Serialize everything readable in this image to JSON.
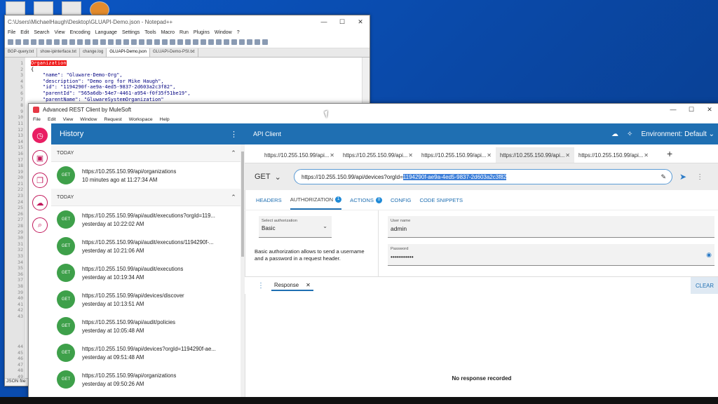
{
  "notepad": {
    "title": "C:\\Users\\MichaelHaugh\\Desktop\\GLUAPI-Demo.json - Notepad++",
    "menu": [
      "File",
      "Edit",
      "Search",
      "View",
      "Encoding",
      "Language",
      "Settings",
      "Tools",
      "Macro",
      "Run",
      "Plugins",
      "Window",
      "?"
    ],
    "tabs": [
      "BGP-query.txt",
      "show-ipinterface.txt",
      "change.log",
      "GLUAPI-Demo.json",
      "GLUAPI-Demo-PSI.txt"
    ],
    "active_tab_index": 3,
    "line_numbers": [
      "1",
      "2",
      "3",
      "4",
      "5",
      "6",
      "7",
      "8",
      "9",
      "10",
      "11",
      "12",
      "13",
      "14",
      "15",
      "16",
      "17",
      "18",
      "19",
      "20",
      "21",
      "22",
      "23",
      "24",
      "25",
      "26",
      "27",
      "28",
      "29",
      "30",
      "31",
      "32",
      "33",
      "34",
      "35",
      "36",
      "37",
      "38",
      "39",
      "40",
      "41",
      "42",
      "43",
      "",
      "",
      "",
      "",
      "44",
      "45",
      "46",
      "47",
      "48",
      "49"
    ],
    "code_lines": [
      {
        "text": "",
        "type": "plain"
      },
      {
        "text": "Organization",
        "type": "hl"
      },
      {
        "text": "{",
        "type": "plain"
      },
      {
        "text": "    \"name\": \"Gluware-Demo-Org\",",
        "type": "kv"
      },
      {
        "text": "    \"description\": \"Demo org for Mike Haugh\",",
        "type": "kv"
      },
      {
        "text": "    \"id\": \"1194290f-ae9a-4ed5-9837-2d603a2c3f82\",",
        "type": "kv"
      },
      {
        "text": "    \"parentId\": \"565a6db-54e7-4461-a954-f0f35f51be19\",",
        "type": "kv"
      },
      {
        "text": "    \"parentName\": \"GluwareSystemOrganization\"",
        "type": "kv"
      }
    ],
    "status": "JSON file"
  },
  "arc": {
    "title": "Advanced REST Client by MuleSoft",
    "menu": [
      "File",
      "Edit",
      "View",
      "Window",
      "Request",
      "Workspace",
      "Help"
    ],
    "history_title": "History",
    "groups": [
      {
        "label": "TODAY",
        "items": [
          {
            "method": "GET",
            "url": "https://10.255.150.99/api/organizations",
            "time": "10 minutes ago at 11:27:34 AM"
          }
        ]
      },
      {
        "label": "TODAY",
        "items": [
          {
            "method": "GET",
            "url": "https://10.255.150.99/api/audit/executions?orgId=119...",
            "time": "yesterday at 10:22:02 AM"
          },
          {
            "method": "GET",
            "url": "https://10.255.150.99/api/audit/executions/1194290f-...",
            "time": "yesterday at 10:21:06 AM"
          },
          {
            "method": "GET",
            "url": "https://10.255.150.99/api/audit/executions",
            "time": "yesterday at 10:19:34 AM"
          },
          {
            "method": "GET",
            "url": "https://10.255.150.99/api/devices/discover",
            "time": "yesterday at 10:13:51 AM"
          },
          {
            "method": "GET",
            "url": "https://10.255.150.99/api/audit/policies",
            "time": "yesterday at 10:05:48 AM"
          },
          {
            "method": "GET",
            "url": "https://10.255.150.99/api/devices?orgId=1194290f-ae...",
            "time": "yesterday at 09:51:48 AM"
          },
          {
            "method": "GET",
            "url": "https://10.255.150.99/api/organizations",
            "time": "yesterday at 09:50:26 AM"
          }
        ]
      }
    ],
    "client_title": "API Client",
    "environment": "Environment: Default",
    "request_tabs": [
      "https://10.255.150.99/api...",
      "https://10.255.150.99/api...",
      "https://10.255.150.99/api...",
      "https://10.255.150.99/api...",
      "https://10.255.150.99/api..."
    ],
    "active_request_tab": 3,
    "method": "GET",
    "url_prefix": "https://10.255.150.99/api/devices?orgId=",
    "url_selected": "1194290f-ae9a-4ed5-9837-2d603a2c3f82",
    "sub_tabs": [
      {
        "label": "HEADERS",
        "count": null
      },
      {
        "label": "AUTHORIZATION",
        "count": "1"
      },
      {
        "label": "ACTIONS",
        "count": "0"
      },
      {
        "label": "CONFIG",
        "count": null
      },
      {
        "label": "CODE SNIPPETS",
        "count": null
      }
    ],
    "active_sub_tab": 1,
    "auth_select_label": "Select authorization",
    "auth_select_value": "Basic",
    "auth_description": "Basic authorization allows to send a username and a password in a request header.",
    "username_label": "User name",
    "username_value": "admin",
    "password_label": "Password",
    "password_value": "•••••••••••",
    "response_tab": "Response",
    "clear_label": "CLEAR",
    "no_response": "No response recorded"
  },
  "colors": {
    "accent": "#1f6fb2",
    "get_badge": "#3ea04a",
    "rail_active": "#e91e63"
  }
}
